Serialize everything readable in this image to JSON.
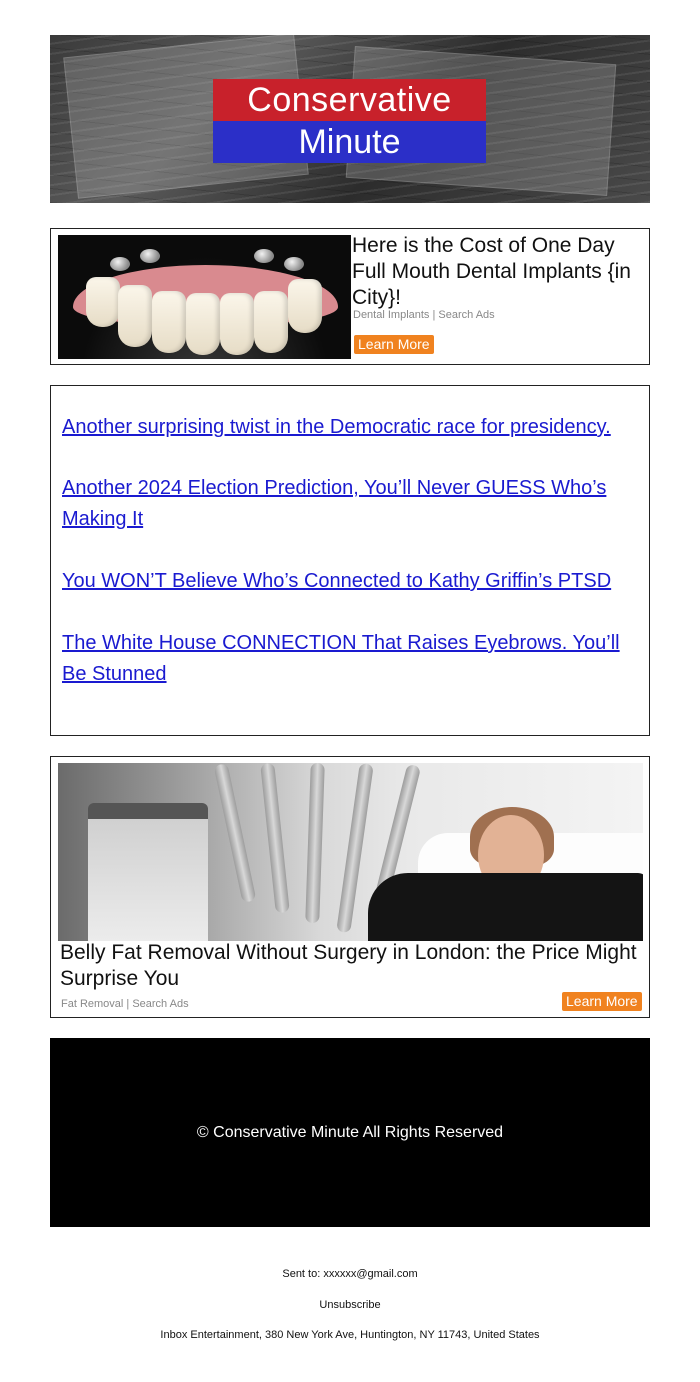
{
  "header": {
    "logo_line1": "Conservative",
    "logo_line2": "Minute"
  },
  "ad1": {
    "title": "Here is the Cost of One Day Full Mouth Dental Implants {in City}!",
    "source": "Dental Implants | Search Ads",
    "button": "Learn More"
  },
  "links": [
    "Another surprising twist in the Democratic race for presidency.",
    "Another 2024 Election Prediction, You’ll Never GUESS Who’s Making It",
    "You WON’T Believe Who’s Connected to Kathy Griffin’s PTSD",
    "The White House CONNECTION That Raises Eyebrows. You’ll Be Stunned"
  ],
  "ad2": {
    "title": "Belly Fat Removal Without Surgery in London: the Price Might Surprise You",
    "source": "Fat Removal | Search Ads",
    "button": "Learn More"
  },
  "footer": {
    "copyright": "© Conservative Minute All Rights Reserved"
  },
  "meta": {
    "sent_to_label": "Sent to:",
    "sent_to_email": "xxxxxx@gmail.com",
    "unsubscribe": "Unsubscribe",
    "address": "Inbox Entertainment, 380 New York Ave, Huntington, NY 11743, United States"
  },
  "colors": {
    "logo_red": "#c8212b",
    "logo_blue": "#2b2fc8",
    "link_blue": "#1a1ad0",
    "button_orange": "#f0821f"
  }
}
